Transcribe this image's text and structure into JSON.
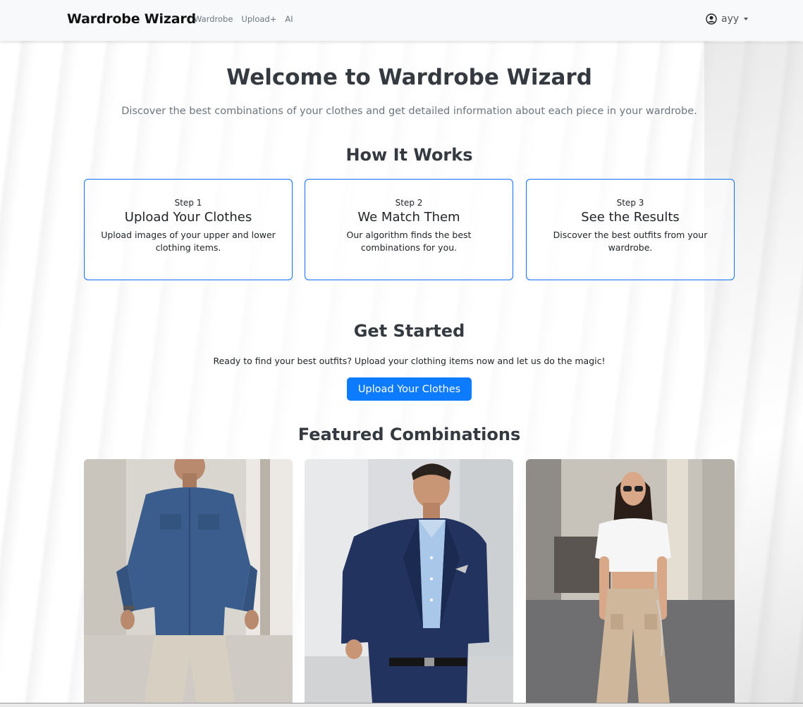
{
  "navbar": {
    "brand": "Wardrobe Wizard",
    "links": [
      "Wardrobe",
      "Upload+",
      "AI"
    ],
    "user_name": "ayy"
  },
  "hero": {
    "title": "Welcome to Wardrobe Wizard",
    "subtitle": "Discover the best combinations of your clothes and get detailed information about each piece in your wardrobe."
  },
  "how_it_works": {
    "title": "How It Works",
    "steps": [
      {
        "label": "Step 1",
        "title": "Upload Your Clothes",
        "text": "Upload images of your upper and lower clothing items."
      },
      {
        "label": "Step 2",
        "title": "We Match Them",
        "text": "Our algorithm finds the best combinations for you."
      },
      {
        "label": "Step 3",
        "title": "See the Results",
        "text": "Discover the best outfits from your wardrobe."
      }
    ]
  },
  "get_started": {
    "title": "Get Started",
    "text": "Ready to find your best outfits? Upload your clothing items now and let us do the magic!",
    "button": "Upload Your Clothes"
  },
  "featured": {
    "title": "Featured Combinations"
  },
  "colors": {
    "accent": "#0d7bfd",
    "card_border": "#0d6efd",
    "heading": "#343a40",
    "muted": "#6c757d"
  }
}
